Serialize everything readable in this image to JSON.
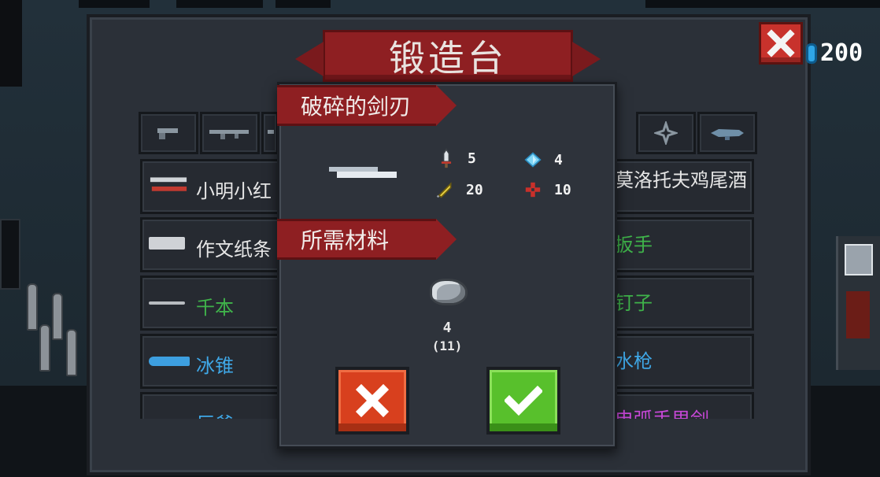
{
  "header": {
    "title": "锻造台",
    "currency_value": "200"
  },
  "colors": {
    "white": "#e6e6e6",
    "green": "#3fb34a",
    "blue": "#3fa8e8",
    "purple": "#c848d8"
  },
  "tabs": [
    {
      "icon": "pistol-icon"
    },
    {
      "icon": "rifle-icon"
    },
    {
      "icon": "weapon-icon"
    },
    {
      "icon": "shuriken-icon"
    },
    {
      "icon": "fish-gun-icon"
    }
  ],
  "recipe_list": [
    {
      "left": "小明小红",
      "right": "莫洛托夫鸡尾酒",
      "left_color": "white",
      "right_color": "white"
    },
    {
      "left": "作文纸条",
      "right": "扳手",
      "left_color": "white",
      "right_color": "green"
    },
    {
      "left": "千本",
      "right": "钉子",
      "left_color": "green",
      "right_color": "green"
    },
    {
      "left": "冰锥",
      "right": "水枪",
      "left_color": "blue",
      "right_color": "blue"
    },
    {
      "left": "巨斧",
      "right": "电弧手里剑",
      "left_color": "blue",
      "right_color": "purple"
    }
  ],
  "dialog": {
    "item_name": "破碎的剑刃",
    "stats": {
      "damage": "5",
      "energy": "4",
      "crit": "20",
      "accuracy": "10"
    },
    "materials_label": "所需材料",
    "material": {
      "icon": "ore-icon",
      "required": "4",
      "owned": "(11)"
    }
  }
}
